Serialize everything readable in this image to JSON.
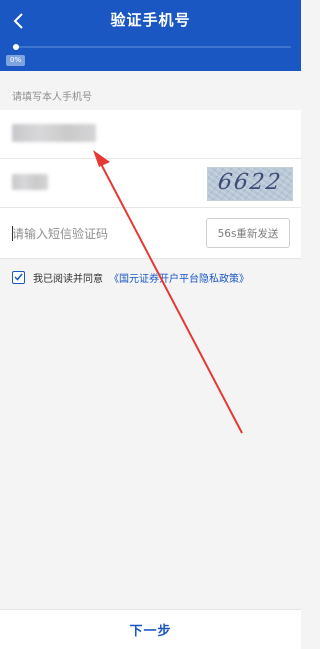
{
  "header": {
    "title": "验证手机号",
    "progress_label": "0%",
    "progress": 0
  },
  "form": {
    "section_hint": "请填写本人手机号",
    "captcha_text": "6622",
    "sms_placeholder": "请输入短信验证码",
    "resend_label": "56s重新发送"
  },
  "agreement": {
    "checked": true,
    "text": "我已阅读并同意",
    "link": "《国元证券开户平台隐私政策》"
  },
  "footer": {
    "next_label": "下一步"
  },
  "colors": {
    "brand": "#1b57c2",
    "annotation_arrow": "#e53935"
  },
  "icons": [
    "back-arrow-icon",
    "checkmark-icon"
  ]
}
